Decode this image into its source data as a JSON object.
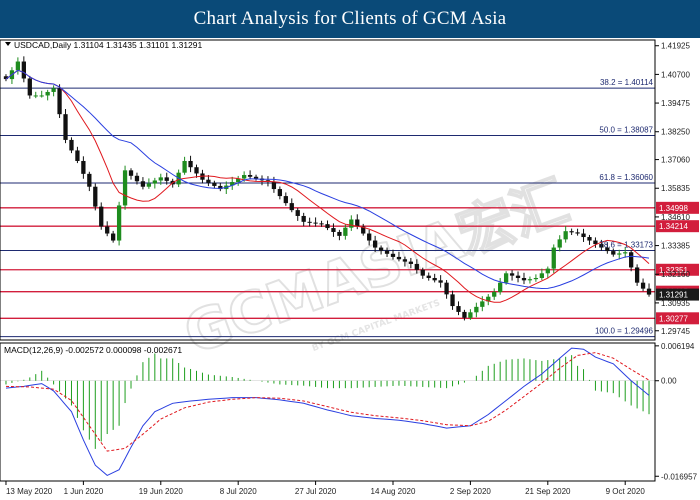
{
  "banner": {
    "title": "Chart Analysis for Clients of GCM Asia"
  },
  "watermark": {
    "text": "GCMASIA宏汇",
    "subtext": "BY GCM CAPITAL MARKETS"
  },
  "colors": {
    "banner": "#0a4a78",
    "candle_up": "#1e8c1e",
    "candle_down": "#111111",
    "ma_fast": "#e0191f",
    "ma_slow": "#2a3fe0",
    "fib_line": "#1e2a70",
    "sr_line": "#d21e3c",
    "sr_label_bg": "#d21e3c",
    "price_label_bg": "#1a1a1a",
    "macd_line": "#2a3fe0",
    "macd_signal": "#e0191f",
    "macd_hist": "#1e9e1e"
  },
  "chart_data": {
    "type": "candlestick",
    "symbol_line": "USDCAD,Daily  1.31104 1.31435 1.31101 1.31291",
    "price_axis_ticks": [
      "1.41925",
      "1.40700",
      "1.39475",
      "1.38250",
      "1.37060",
      "1.35835",
      "1.34610",
      "1.33385",
      "1.32160",
      "1.30935",
      "1.29745"
    ],
    "price_range": [
      1.2935,
      1.4217
    ],
    "x_labels": [
      "13 May 2020",
      "1 Jun 2020",
      "19 Jun 2020",
      "8 Jul 2020",
      "27 Jul 2020",
      "14 Aug 2020",
      "2 Sep 2020",
      "21 Sep 2020",
      "9 Oct 2020"
    ],
    "x_label_bars": [
      0,
      13,
      26,
      39,
      52,
      65,
      78,
      91,
      104
    ],
    "bar_count": 109,
    "fib_levels": [
      {
        "label": "38.2 = 1.40114",
        "value": 1.40114
      },
      {
        "label": "50.0 = 1.38087",
        "value": 1.38087
      },
      {
        "label": "61.8 = 1.36060",
        "value": 1.3606
      },
      {
        "label": "78.6 = 1.33173",
        "value": 1.33173
      },
      {
        "label": "100.0 = 1.29496",
        "value": 1.29496
      }
    ],
    "sr_levels": [
      {
        "label": "1.34998",
        "value": 1.34998
      },
      {
        "label": "1.34214",
        "value": 1.34214
      },
      {
        "label": "1.32351",
        "value": 1.32351
      },
      {
        "label": "1.31415",
        "value": 1.31415
      },
      {
        "label": "1.30277",
        "value": 1.30277
      }
    ],
    "current_price": {
      "label": "1.31291",
      "value": 1.31291
    },
    "price_anchors": [
      [
        0,
        1.405
      ],
      [
        2,
        1.4125
      ],
      [
        4,
        1.398
      ],
      [
        6,
        1.398
      ],
      [
        8,
        1.401
      ],
      [
        10,
        1.379
      ],
      [
        12,
        1.37
      ],
      [
        14,
        1.359
      ],
      [
        16,
        1.342
      ],
      [
        18,
        1.336
      ],
      [
        20,
        1.366
      ],
      [
        23,
        1.359
      ],
      [
        26,
        1.363
      ],
      [
        28,
        1.36
      ],
      [
        30,
        1.37
      ],
      [
        33,
        1.362
      ],
      [
        36,
        1.358
      ],
      [
        40,
        1.364
      ],
      [
        44,
        1.361
      ],
      [
        48,
        1.349
      ],
      [
        50,
        1.344
      ],
      [
        53,
        1.343
      ],
      [
        56,
        1.338
      ],
      [
        58,
        1.345
      ],
      [
        60,
        1.339
      ],
      [
        62,
        1.333
      ],
      [
        65,
        1.329
      ],
      [
        68,
        1.326
      ],
      [
        70,
        1.321
      ],
      [
        73,
        1.318
      ],
      [
        75,
        1.308
      ],
      [
        77,
        1.303
      ],
      [
        80,
        1.31
      ],
      [
        82,
        1.314
      ],
      [
        84,
        1.322
      ],
      [
        87,
        1.319
      ],
      [
        89,
        1.32
      ],
      [
        91,
        1.324
      ],
      [
        92,
        1.333
      ],
      [
        94,
        1.34
      ],
      [
        96,
        1.339
      ],
      [
        98,
        1.336
      ],
      [
        100,
        1.333
      ],
      [
        102,
        1.33
      ],
      [
        104,
        1.331
      ],
      [
        106,
        1.318
      ],
      [
        108,
        1.3129
      ]
    ],
    "macd": {
      "label": "MACD(12,26,9) -0.002572 0.000098 -0.002671",
      "axis_ticks": [
        "0.006194",
        "0.00",
        "-0.016957"
      ],
      "range": [
        -0.0178,
        0.0067
      ],
      "macd_anchors": [
        [
          0,
          -0.0013
        ],
        [
          3,
          -0.001
        ],
        [
          6,
          -0.0005
        ],
        [
          8,
          -0.0018
        ],
        [
          11,
          -0.0055
        ],
        [
          13,
          -0.0105
        ],
        [
          15,
          -0.015
        ],
        [
          17,
          -0.0168
        ],
        [
          19,
          -0.0158
        ],
        [
          21,
          -0.0118
        ],
        [
          23,
          -0.008
        ],
        [
          25,
          -0.0055
        ],
        [
          28,
          -0.004
        ],
        [
          31,
          -0.0036
        ],
        [
          34,
          -0.0033
        ],
        [
          38,
          -0.003
        ],
        [
          42,
          -0.003
        ],
        [
          46,
          -0.0034
        ],
        [
          50,
          -0.004
        ],
        [
          54,
          -0.0052
        ],
        [
          58,
          -0.0062
        ],
        [
          62,
          -0.0067
        ],
        [
          66,
          -0.007
        ],
        [
          70,
          -0.0076
        ],
        [
          74,
          -0.0084
        ],
        [
          78,
          -0.008
        ],
        [
          81,
          -0.006
        ],
        [
          84,
          -0.0035
        ],
        [
          87,
          -0.001
        ],
        [
          90,
          0.0012
        ],
        [
          93,
          0.004
        ],
        [
          95,
          0.0058
        ],
        [
          97,
          0.0056
        ],
        [
          99,
          0.0042
        ],
        [
          102,
          0.003
        ],
        [
          105,
          0.0
        ],
        [
          108,
          -0.0026
        ]
      ],
      "signal_anchors": [
        [
          0,
          -0.001
        ],
        [
          4,
          -0.0011
        ],
        [
          8,
          -0.0015
        ],
        [
          11,
          -0.0035
        ],
        [
          14,
          -0.008
        ],
        [
          17,
          -0.0125
        ],
        [
          20,
          -0.012
        ],
        [
          23,
          -0.0095
        ],
        [
          26,
          -0.0068
        ],
        [
          30,
          -0.0048
        ],
        [
          34,
          -0.0038
        ],
        [
          38,
          -0.0033
        ],
        [
          42,
          -0.003
        ],
        [
          46,
          -0.0031
        ],
        [
          50,
          -0.0036
        ],
        [
          54,
          -0.0046
        ],
        [
          58,
          -0.0056
        ],
        [
          62,
          -0.0062
        ],
        [
          66,
          -0.0066
        ],
        [
          70,
          -0.0071
        ],
        [
          74,
          -0.0078
        ],
        [
          78,
          -0.008
        ],
        [
          81,
          -0.0072
        ],
        [
          84,
          -0.0052
        ],
        [
          87,
          -0.0028
        ],
        [
          90,
          -0.0004
        ],
        [
          93,
          0.0022
        ],
        [
          96,
          0.0045
        ],
        [
          99,
          0.005
        ],
        [
          102,
          0.004
        ],
        [
          105,
          0.002
        ],
        [
          108,
          0.0001
        ]
      ]
    }
  }
}
